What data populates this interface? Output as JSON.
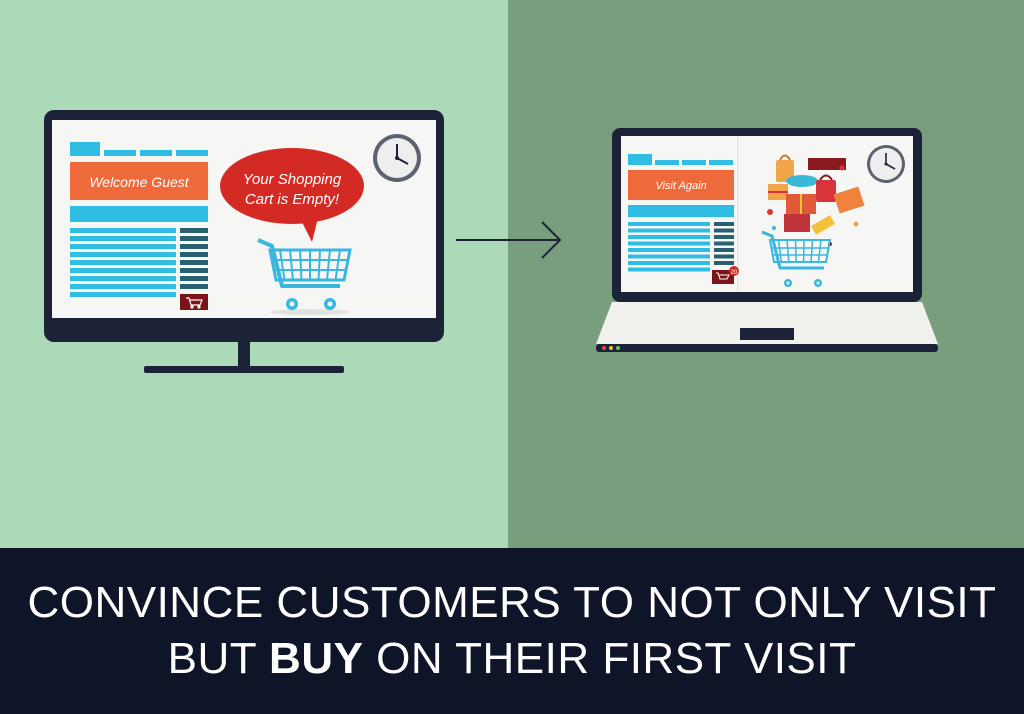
{
  "colors": {
    "left_bg": "#acd9b8",
    "right_bg": "#789e7e",
    "banner_bg": "#0e1529",
    "device_frame": "#1c2338",
    "screen": "#f6f6f4",
    "accent_orange": "#ef6a3b",
    "accent_blue": "#2fbde3",
    "dark_teal": "#2a6170",
    "bubble_red": "#d42a24",
    "cart_blue": "#3ab7e0"
  },
  "desktop": {
    "welcome_label": "Welcome Guest",
    "bubble_line1": "Your Shopping",
    "bubble_line2": "Cart is Empty!"
  },
  "laptop": {
    "visit_label": "Visit Again",
    "cart_badge": "20"
  },
  "banner": {
    "line1": "CONVINCE CUSTOMERS TO NOT ONLY VISIT",
    "line2_pre": "BUT ",
    "line2_bold": "BUY",
    "line2_post": " ON THEIR FIRST VISIT"
  },
  "icons": {
    "clock": "clock-icon",
    "cart": "shopping-cart-icon",
    "arrow": "arrow-right-icon"
  }
}
